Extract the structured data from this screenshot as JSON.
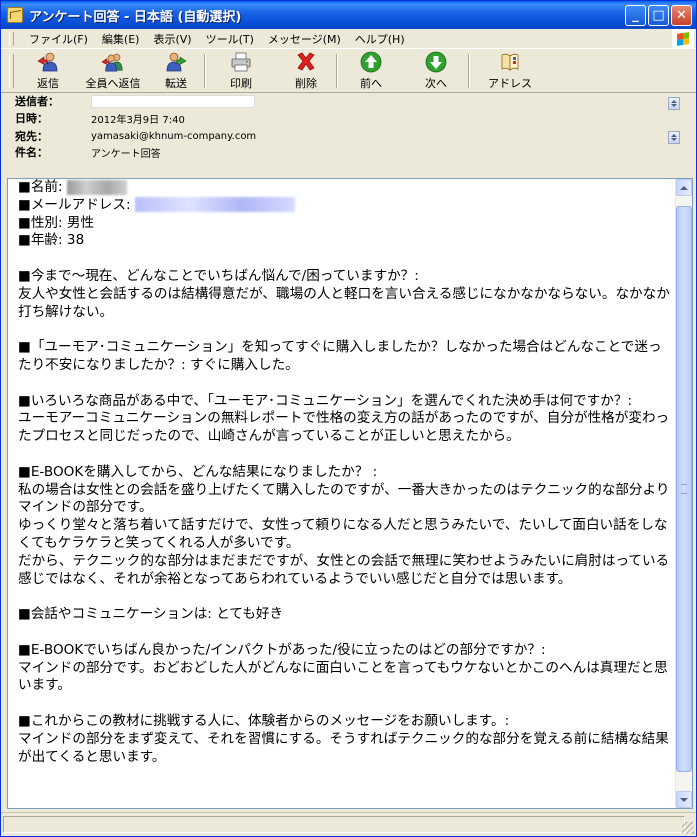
{
  "window": {
    "title": "アンケート回答 - 日本語 (自動選択)"
  },
  "titlebar_buttons": {
    "minimize": "_",
    "maximize": "□",
    "close": "✕"
  },
  "menu": [
    {
      "id": "file",
      "label": "ファイル(F)"
    },
    {
      "id": "edit",
      "label": "編集(E)"
    },
    {
      "id": "view",
      "label": "表示(V)"
    },
    {
      "id": "tools",
      "label": "ツール(T)"
    },
    {
      "id": "message",
      "label": "メッセージ(M)"
    },
    {
      "id": "help",
      "label": "ヘルプ(H)"
    }
  ],
  "toolbar": {
    "reply": "返信",
    "reply_all": "全員へ返信",
    "forward": "転送",
    "print": "印刷",
    "delete": "削除",
    "previous": "前へ",
    "next": "次へ",
    "addresses": "アドレス"
  },
  "header": {
    "from_label": "送信者：",
    "date_label": "日時：",
    "date_value": "2012年3月9日 7:40",
    "to_label": "宛先：",
    "to_value": "yamasaki@khnum-company.com",
    "subject_label": "件名：",
    "subject_value": "アンケート回答"
  },
  "body": {
    "name_label": "■名前: ",
    "email_label": "■メールアドレス: ",
    "rest": "■性別: 男性\n■年齢: 38\n\n■今まで〜現在、どんなことでいちばん悩んで/困っていますか？:\n友人や女性と会話するのは結構得意だが、職場の人と軽口を言い合える感じになかなかならない。なかなか打ち解けない。\n\n■「ユーモア･コミュニケーション」を知ってすぐに購入しましたか？しなかった場合はどんなことで迷ったり不安になりましたか？: すぐに購入した。\n\n■いろいろな商品がある中で、「ユーモア･コミュニケーション」を選んでくれた決め手は何ですか？:\nユーモアーコミュニケーションの無料レポートで性格の変え方の話があったのですが、自分が性格が変わったプロセスと同じだったので、山崎さんが言っていることが正しいと思えたから。\n\n■E-BOOKを購入してから、どんな結果になりましたか？ :\n私の場合は女性との会話を盛り上げたくて購入したのですが、一番大きかったのはテクニック的な部分よりマインドの部分です。\nゆっくり堂々と落ち着いて話すだけで、女性って頼りになる人だと思うみたいで、たいして面白い話をしなくてもケラケラと笑ってくれる人が多いです。\nだから、テクニック的な部分はまだまだですが、女性との会話で無理に笑わせようみたいに肩肘はっている感じではなく、それが余裕となってあらわれているようでいい感じだと自分では思います。\n\n■会話やコミュニケーションは: とても好き\n\n■E-BOOKでいちばん良かった/インパクトがあった/役に立ったのはどの部分ですか？:\nマインドの部分です。おどおどした人がどんなに面白いことを言ってもウケないとかこのへんは真理だと思います。\n\n■これからこの教材に挑戦する人に、体験者からのメッセージをお願いします。:\nマインドの部分をまず変えて、それを習慣にする。そうすればテクニック的な部分を覚える前に結構な結果が出てくると思います。"
  },
  "icons": {
    "reply": "reply-icon",
    "reply_all": "reply-all-icon",
    "forward": "forward-icon",
    "print": "printer-icon",
    "delete": "delete-x-icon",
    "previous": "up-arrow-icon",
    "next": "down-arrow-icon",
    "addresses": "address-book-icon"
  },
  "colors": {
    "titlebar": "#0A50D8",
    "window_bg": "#ECE9D8",
    "nav_green": "#2FA12F",
    "delete_red": "#E02020"
  }
}
